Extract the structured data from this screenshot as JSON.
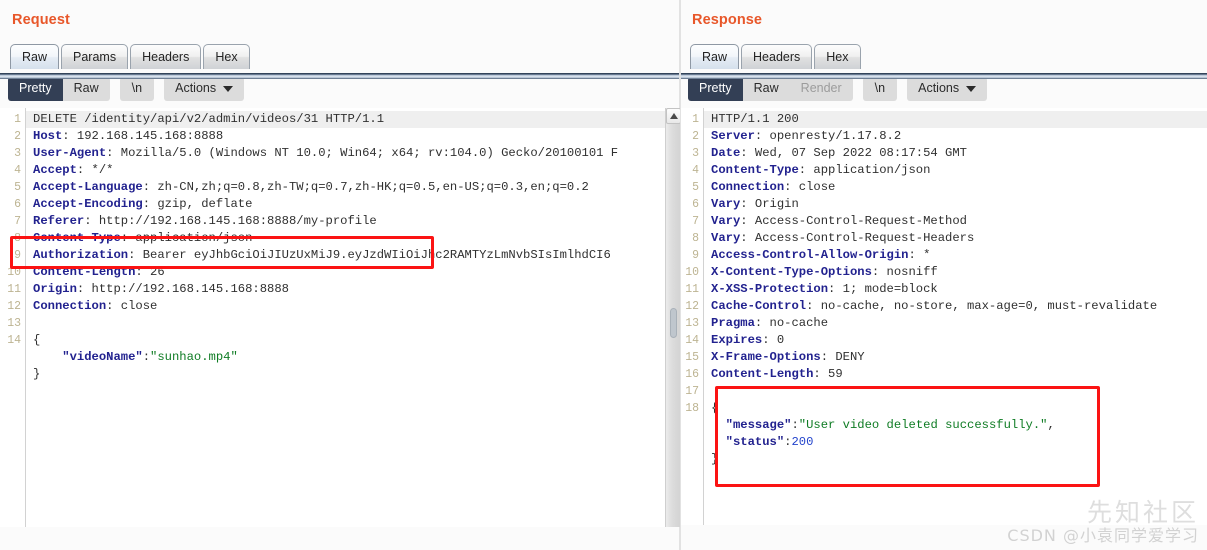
{
  "request": {
    "title": "Request",
    "tabs": [
      {
        "label": "Raw",
        "active": true
      },
      {
        "label": "Params",
        "active": false
      },
      {
        "label": "Headers",
        "active": false
      },
      {
        "label": "Hex",
        "active": false
      }
    ],
    "controls": {
      "pretty": "Pretty",
      "raw": "Raw",
      "newline": "\\n",
      "actions": "Actions"
    },
    "lines": [
      {
        "n": "1",
        "highlight": true,
        "parts": [
          {
            "t": "DELETE /identity/api/v2/admin/videos/31 HTTP/1.1",
            "c": "v"
          }
        ]
      },
      {
        "n": "2",
        "highlight": false,
        "parts": [
          {
            "t": "Host",
            "c": "k"
          },
          {
            "t": ": 192.168.145.168:8888",
            "c": "v"
          }
        ]
      },
      {
        "n": "3",
        "highlight": false,
        "parts": [
          {
            "t": "User-Agent",
            "c": "k"
          },
          {
            "t": ": Mozilla/5.0 (Windows NT 10.0; Win64; x64; rv:104.0) Gecko/20100101 F",
            "c": "v"
          }
        ]
      },
      {
        "n": "4",
        "highlight": false,
        "parts": [
          {
            "t": "Accept",
            "c": "k"
          },
          {
            "t": ": */*",
            "c": "v"
          }
        ]
      },
      {
        "n": "5",
        "highlight": false,
        "parts": [
          {
            "t": "Accept-Language",
            "c": "k"
          },
          {
            "t": ": zh-CN,zh;q=0.8,zh-TW;q=0.7,zh-HK;q=0.5,en-US;q=0.3,en;q=0.2",
            "c": "v"
          }
        ]
      },
      {
        "n": "6",
        "highlight": false,
        "parts": [
          {
            "t": "Accept-Encoding",
            "c": "k"
          },
          {
            "t": ": gzip, deflate",
            "c": "v"
          }
        ]
      },
      {
        "n": "7",
        "highlight": false,
        "parts": [
          {
            "t": "Referer",
            "c": "k"
          },
          {
            "t": ": http://192.168.145.168:8888/my-profile",
            "c": "v"
          }
        ]
      },
      {
        "n": "8",
        "highlight": false,
        "parts": [
          {
            "t": "Content-Type",
            "c": "k"
          },
          {
            "t": ": application/json",
            "c": "v"
          }
        ]
      },
      {
        "n": "9",
        "highlight": false,
        "parts": [
          {
            "t": "Authorization",
            "c": "k"
          },
          {
            "t": ": Bearer eyJhbGciOiJIUzUxMiJ9.eyJzdWIiOiJhc2RAMTYzLmNvbSIsImlhdCI6",
            "c": "v"
          }
        ]
      },
      {
        "n": "10",
        "highlight": false,
        "parts": [
          {
            "t": "Content-Length",
            "c": "k"
          },
          {
            "t": ": 26",
            "c": "v"
          }
        ]
      },
      {
        "n": "11",
        "highlight": false,
        "parts": [
          {
            "t": "Origin",
            "c": "k"
          },
          {
            "t": ": http://192.168.145.168:8888",
            "c": "v"
          }
        ]
      },
      {
        "n": "12",
        "highlight": false,
        "parts": [
          {
            "t": "Connection",
            "c": "k"
          },
          {
            "t": ": close",
            "c": "v"
          }
        ]
      },
      {
        "n": "13",
        "highlight": false,
        "parts": []
      },
      {
        "n": "14",
        "highlight": false,
        "parts": [
          {
            "t": "{",
            "c": "v"
          }
        ]
      },
      {
        "n": "",
        "highlight": false,
        "parts": [
          {
            "t": "    ",
            "c": "v"
          },
          {
            "t": "\"videoName\"",
            "c": "jk"
          },
          {
            "t": ":",
            "c": "v"
          },
          {
            "t": "\"sunhao.mp4\"",
            "c": "str"
          }
        ]
      },
      {
        "n": "",
        "highlight": false,
        "parts": [
          {
            "t": "}",
            "c": "v"
          }
        ]
      }
    ]
  },
  "response": {
    "title": "Response",
    "tabs": [
      {
        "label": "Raw",
        "active": true
      },
      {
        "label": "Headers",
        "active": false
      },
      {
        "label": "Hex",
        "active": false
      }
    ],
    "controls": {
      "pretty": "Pretty",
      "raw": "Raw",
      "render": "Render",
      "newline": "\\n",
      "actions": "Actions"
    },
    "lines": [
      {
        "n": "1",
        "highlight": true,
        "parts": [
          {
            "t": "HTTP/1.1 200",
            "c": "v"
          }
        ]
      },
      {
        "n": "2",
        "highlight": false,
        "parts": [
          {
            "t": "Server",
            "c": "k"
          },
          {
            "t": ": openresty/1.17.8.2",
            "c": "v"
          }
        ]
      },
      {
        "n": "3",
        "highlight": false,
        "parts": [
          {
            "t": "Date",
            "c": "k"
          },
          {
            "t": ": Wed, 07 Sep 2022 08:17:54 GMT",
            "c": "v"
          }
        ]
      },
      {
        "n": "4",
        "highlight": false,
        "parts": [
          {
            "t": "Content-Type",
            "c": "k"
          },
          {
            "t": ": application/json",
            "c": "v"
          }
        ]
      },
      {
        "n": "5",
        "highlight": false,
        "parts": [
          {
            "t": "Connection",
            "c": "k"
          },
          {
            "t": ": close",
            "c": "v"
          }
        ]
      },
      {
        "n": "6",
        "highlight": false,
        "parts": [
          {
            "t": "Vary",
            "c": "k"
          },
          {
            "t": ": Origin",
            "c": "v"
          }
        ]
      },
      {
        "n": "7",
        "highlight": false,
        "parts": [
          {
            "t": "Vary",
            "c": "k"
          },
          {
            "t": ": Access-Control-Request-Method",
            "c": "v"
          }
        ]
      },
      {
        "n": "8",
        "highlight": false,
        "parts": [
          {
            "t": "Vary",
            "c": "k"
          },
          {
            "t": ": Access-Control-Request-Headers",
            "c": "v"
          }
        ]
      },
      {
        "n": "9",
        "highlight": false,
        "parts": [
          {
            "t": "Access-Control-Allow-Origin",
            "c": "k"
          },
          {
            "t": ": *",
            "c": "v"
          }
        ]
      },
      {
        "n": "10",
        "highlight": false,
        "parts": [
          {
            "t": "X-Content-Type-Options",
            "c": "k"
          },
          {
            "t": ": nosniff",
            "c": "v"
          }
        ]
      },
      {
        "n": "11",
        "highlight": false,
        "parts": [
          {
            "t": "X-XSS-Protection",
            "c": "k"
          },
          {
            "t": ": 1; mode=block",
            "c": "v"
          }
        ]
      },
      {
        "n": "12",
        "highlight": false,
        "parts": [
          {
            "t": "Cache-Control",
            "c": "k"
          },
          {
            "t": ": no-cache, no-store, max-age=0, must-revalidate",
            "c": "v"
          }
        ]
      },
      {
        "n": "13",
        "highlight": false,
        "parts": [
          {
            "t": "Pragma",
            "c": "k"
          },
          {
            "t": ": no-cache",
            "c": "v"
          }
        ]
      },
      {
        "n": "14",
        "highlight": false,
        "parts": [
          {
            "t": "Expires",
            "c": "k"
          },
          {
            "t": ": 0",
            "c": "v"
          }
        ]
      },
      {
        "n": "15",
        "highlight": false,
        "parts": [
          {
            "t": "X-Frame-Options",
            "c": "k"
          },
          {
            "t": ": DENY",
            "c": "v"
          }
        ]
      },
      {
        "n": "16",
        "highlight": false,
        "parts": [
          {
            "t": "Content-Length",
            "c": "k"
          },
          {
            "t": ": 59",
            "c": "v"
          }
        ]
      },
      {
        "n": "17",
        "highlight": false,
        "parts": []
      },
      {
        "n": "18",
        "highlight": false,
        "parts": [
          {
            "t": "{",
            "c": "v"
          }
        ]
      },
      {
        "n": "",
        "highlight": false,
        "parts": [
          {
            "t": "  ",
            "c": "v"
          },
          {
            "t": "\"message\"",
            "c": "jk"
          },
          {
            "t": ":",
            "c": "v"
          },
          {
            "t": "\"User video deleted successfully.\"",
            "c": "str"
          },
          {
            "t": ",",
            "c": "v"
          }
        ]
      },
      {
        "n": "",
        "highlight": false,
        "parts": [
          {
            "t": "  ",
            "c": "v"
          },
          {
            "t": "\"status\"",
            "c": "jk"
          },
          {
            "t": ":",
            "c": "v"
          },
          {
            "t": "200",
            "c": "num"
          }
        ]
      },
      {
        "n": "",
        "highlight": false,
        "parts": [
          {
            "t": "}",
            "c": "v"
          }
        ]
      }
    ]
  },
  "watermark": {
    "logo": "先知社区",
    "text": "CSDN @小袁同学爱学习"
  },
  "colors": {
    "title": "#e8572a",
    "annotation": "#fb1313",
    "active_button": "#333f55",
    "header_key": "#22228f",
    "string": "#0f7c24",
    "number": "#2344cc"
  }
}
